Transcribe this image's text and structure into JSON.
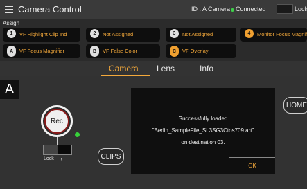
{
  "header": {
    "title": "Camera Control",
    "camera_id": "ID : A Camera",
    "connection_status": "Connected",
    "lock_label": "Lock"
  },
  "assign": {
    "label": "Assign",
    "buttons": [
      {
        "key": "1",
        "label": "VF Highlight Clip Ind"
      },
      {
        "key": "2",
        "label": "Not Assigned"
      },
      {
        "key": "3",
        "label": "Not Assigned"
      },
      {
        "key": "4",
        "label": "Monitor Focus Magnifi"
      },
      {
        "key": "A",
        "label": "VF Focus Magnifier"
      },
      {
        "key": "B",
        "label": "VF False Color"
      },
      {
        "key": "C",
        "label": "VF Overlay"
      }
    ]
  },
  "tabs": [
    "Camera",
    "Lens",
    "Info"
  ],
  "main": {
    "slot": "A",
    "rec_label": "Rec",
    "lock_label": "Lock",
    "clips_label": "CLIPS",
    "home_label": "HOME"
  },
  "dialog": {
    "line1": "Successfully loaded",
    "line2": "\"Berlin_SampleFile_SL3SG3Ctos709.art\"",
    "line3": "on destination 03.",
    "ok_label": "OK"
  },
  "colors": {
    "accent": "#f4a93b",
    "connected": "#3ecf4a",
    "rec_border": "#8b1a1a"
  }
}
